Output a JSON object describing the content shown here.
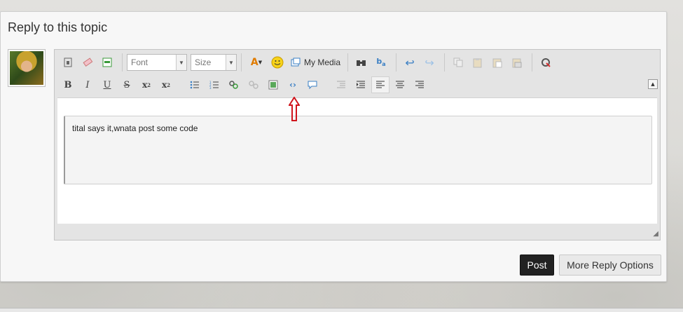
{
  "panel": {
    "title": "Reply to this topic"
  },
  "toolbar": {
    "font_label": "Font",
    "size_label": "Size",
    "my_media_label": "My Media",
    "row1_icons": [
      "source-icon",
      "eraser-icon",
      "paste-text-icon",
      "text-color-icon",
      "smiley-icon",
      "my-media-icon",
      "find-icon",
      "replace-icon",
      "undo-icon",
      "redo-icon",
      "copy-icon",
      "paste-icon",
      "paste-word-icon",
      "paste-special-icon",
      "spellcheck-icon"
    ],
    "row2_icons": [
      "bold-icon",
      "italic-icon",
      "underline-icon",
      "strikethrough-icon",
      "subscript-icon",
      "superscript-icon",
      "bullet-list-icon",
      "numbered-list-icon",
      "link-icon",
      "unlink-icon",
      "image-icon",
      "code-icon",
      "quote-icon",
      "outdent-icon",
      "indent-icon",
      "align-left-icon",
      "align-center-icon",
      "align-right-icon"
    ]
  },
  "editor": {
    "content": "tital says it,wnata post some code"
  },
  "actions": {
    "post_label": "Post",
    "more_label": "More Reply Options"
  },
  "colors": {
    "post_button_bg": "#222222",
    "annotation_arrow": "#d0141c",
    "icon_blue": "#3a7fc4"
  }
}
